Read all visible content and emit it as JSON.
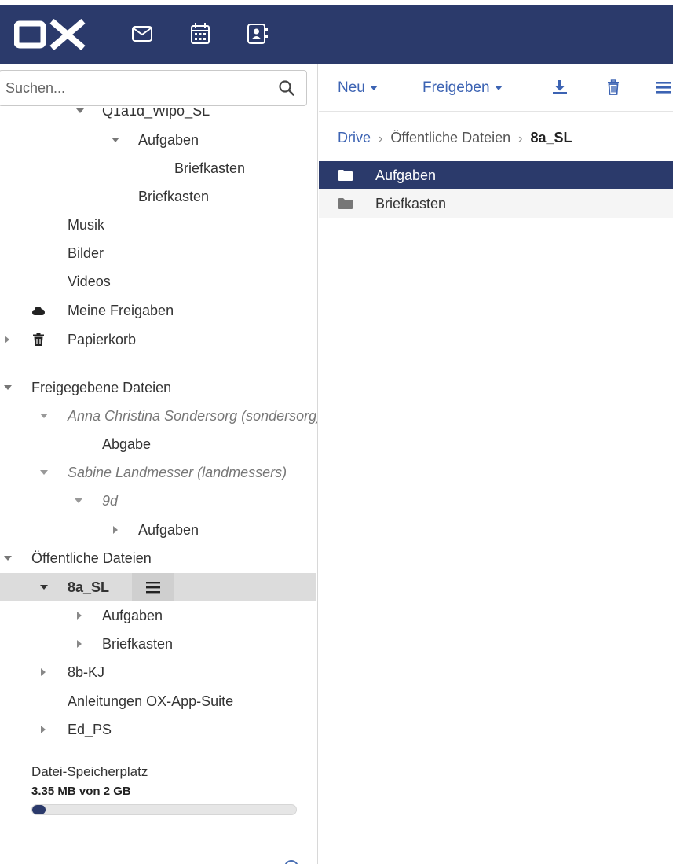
{
  "app": {
    "logo_text": "OX",
    "colors": {
      "topbar": "#2b3a6b",
      "link": "#3c63b3",
      "selection": "#2b3a6b",
      "tree_selected": "#dcdcdc"
    },
    "top_icons": [
      "mail-icon",
      "calendar-icon",
      "contacts-icon"
    ]
  },
  "search": {
    "placeholder": "Suchen...",
    "value": ""
  },
  "tree": {
    "clipped_top_label": "Q1a1d_Wipo_SL",
    "items": [
      {
        "label": "Aufgaben"
      },
      {
        "label": "Briefkasten"
      },
      {
        "label": "Briefkasten"
      },
      {
        "label": "Musik"
      },
      {
        "label": "Bilder"
      },
      {
        "label": "Videos"
      },
      {
        "label": "Meine Freigaben",
        "icon": "cloud-icon"
      },
      {
        "label": "Papierkorb",
        "icon": "trash-icon"
      },
      {
        "label": "Freigegebene Dateien"
      },
      {
        "label": "Anna Christina Sondersorg (sondersorg)"
      },
      {
        "label": "Abgabe"
      },
      {
        "label": "Sabine Landmesser (landmessers)"
      },
      {
        "label": "9d"
      },
      {
        "label": "Aufgaben"
      },
      {
        "label": "Öffentliche Dateien"
      },
      {
        "label": "8a_SL"
      },
      {
        "label": "Aufgaben"
      },
      {
        "label": "Briefkasten"
      },
      {
        "label": "8b-KJ"
      },
      {
        "label": "Anleitungen OX-App-Suite"
      },
      {
        "label": "Ed_PS"
      }
    ]
  },
  "quota": {
    "title": "Datei-Speicherplatz",
    "text": "3.35 MB von 2 GB",
    "used_fraction": 0.05
  },
  "toolbar": {
    "new_label": "Neu",
    "share_label": "Freigeben",
    "download_icon": "download-icon",
    "delete_icon": "trash-icon",
    "more_icon": "menu-icon"
  },
  "breadcrumb": {
    "root": "Drive",
    "separator": "›",
    "middle": "Öffentliche Dateien",
    "current": "8a_SL"
  },
  "files": [
    {
      "name": "Aufgaben",
      "icon": "folder-icon",
      "selected": true
    },
    {
      "name": "Briefkasten",
      "icon": "folder-icon",
      "selected": false
    }
  ]
}
